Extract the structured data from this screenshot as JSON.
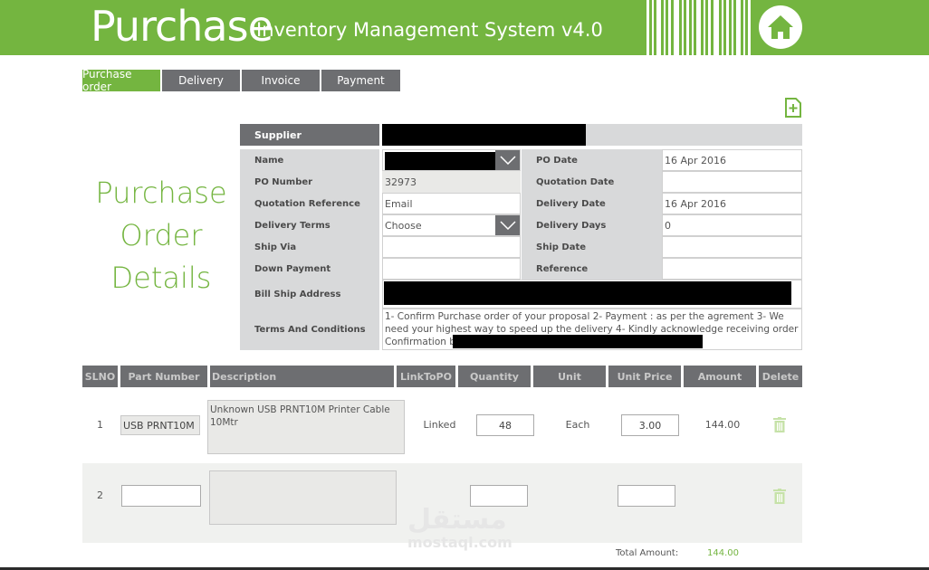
{
  "header": {
    "title": "Purchase",
    "subtitle": "Inventory Management System v4.0",
    "accent": "#74b540"
  },
  "tabs": [
    {
      "label": "Purchase order",
      "active": true
    },
    {
      "label": "Delivery",
      "active": false
    },
    {
      "label": "Invoice",
      "active": false
    },
    {
      "label": "Payment",
      "active": false
    }
  ],
  "page_title_lines": [
    "Purchase",
    "Order",
    "Details"
  ],
  "form": {
    "supplier_label": "Supplier",
    "name_label": "Name",
    "po_number_label": "PO Number",
    "po_number_value": "32973",
    "quotation_reference_label": "Quotation Reference",
    "quotation_reference_value": "Email",
    "delivery_terms_label": "Delivery Terms",
    "delivery_terms_value": "Choose",
    "ship_via_label": "Ship Via",
    "down_payment_label": "Down Payment",
    "bill_ship_label": "Bill Ship Address",
    "terms_label": "Terms And Conditions",
    "terms_value": "1- Confirm Purchase order of your proposal 2- Payment : as per the agrement 3- We need your highest way to speed up the delivery 4- Kindly acknowledge receiving order Confirmation by",
    "po_date_label": "PO Date",
    "po_date_value": "16 Apr 2016",
    "quotation_date_label": "Quotation Date",
    "delivery_date_label": "Delivery Date",
    "delivery_date_value": "16 Apr 2016",
    "delivery_days_label": "Delivery Days",
    "delivery_days_value": "0",
    "ship_date_label": "Ship Date",
    "reference_label": "Reference"
  },
  "grid": {
    "headers": [
      "SLNO",
      "Part Number",
      "Description",
      "LinkToPO",
      "Quantity",
      "Unit",
      "Unit Price",
      "Amount",
      "Delete"
    ],
    "rows": [
      {
        "slno": "1",
        "part_number": "USB PRNT10M",
        "description": "Unknown  USB PRNT10M Printer Cable 10Mtr",
        "link": "Linked",
        "quantity": "48",
        "unit": "Each",
        "unit_price": "3.00",
        "amount": "144.00"
      },
      {
        "slno": "2",
        "part_number": "",
        "description": "",
        "link": "",
        "quantity": "",
        "unit": "",
        "unit_price": "",
        "amount": ""
      }
    ],
    "total_label": "Total Amount:",
    "total_value": "144.00"
  },
  "watermark": {
    "arabic": "مستقل",
    "latin": "mostaql.com"
  },
  "icons": {
    "home": "home-icon",
    "add": "add-file-icon",
    "delete": "trash-icon",
    "dropdown": "chevron-down-icon"
  }
}
